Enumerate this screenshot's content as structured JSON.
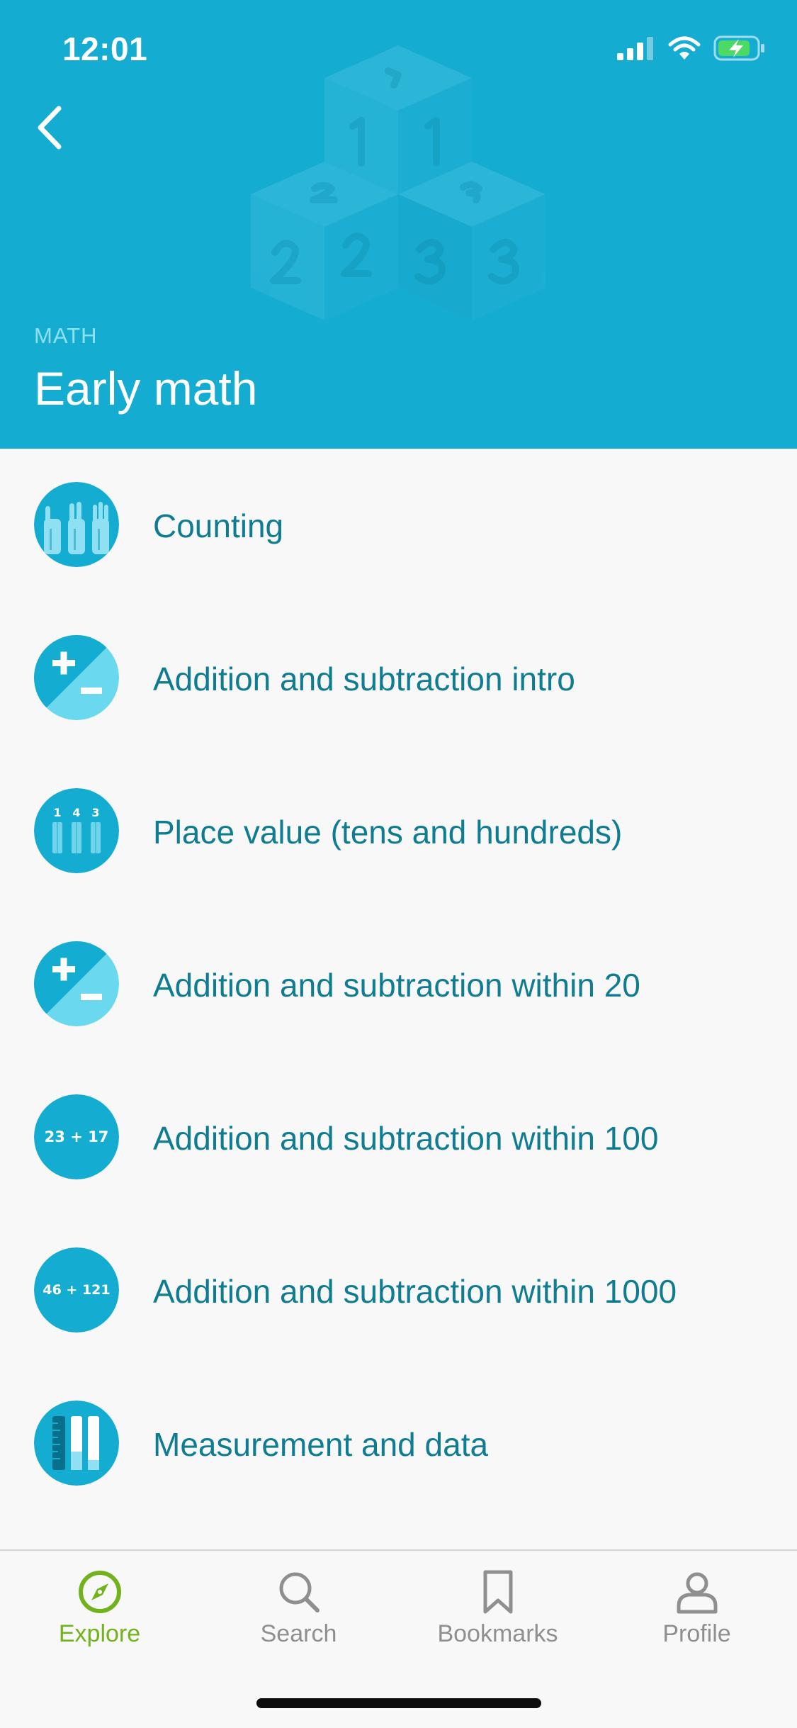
{
  "status_bar": {
    "time": "12:01"
  },
  "header": {
    "subject": "MATH",
    "title": "Early math",
    "background_color": "#14acd1"
  },
  "icons": {
    "back": "chevron-left-icon",
    "signal": "cellular-signal-icon",
    "wifi": "wifi-icon",
    "battery": "battery-charging-icon"
  },
  "topics": [
    {
      "label": "Counting",
      "icon": "raised-fingers-icon"
    },
    {
      "label": "Addition and subtraction intro",
      "icon": "plus-minus-icon"
    },
    {
      "label": "Place value (tens and hundreds)",
      "icon": "place-value-icon",
      "icon_text": [
        "1",
        "4",
        "3"
      ]
    },
    {
      "label": "Addition and subtraction within 20",
      "icon": "plus-minus-icon"
    },
    {
      "label": "Addition and subtraction within 100",
      "icon": "sum-text-icon",
      "icon_text": "23 + 17"
    },
    {
      "label": "Addition and subtraction within 1000",
      "icon": "sum-text-icon",
      "icon_text": "46 + 121"
    },
    {
      "label": "Measurement and data",
      "icon": "ruler-bars-icon"
    }
  ],
  "tab_bar": {
    "active_color": "#72b21c",
    "inactive_color": "#8f8f8f",
    "tabs": [
      {
        "label": "Explore",
        "icon": "compass-icon",
        "active": true
      },
      {
        "label": "Search",
        "icon": "search-icon",
        "active": false
      },
      {
        "label": "Bookmarks",
        "icon": "bookmark-icon",
        "active": false
      },
      {
        "label": "Profile",
        "icon": "person-icon",
        "active": false
      }
    ]
  }
}
